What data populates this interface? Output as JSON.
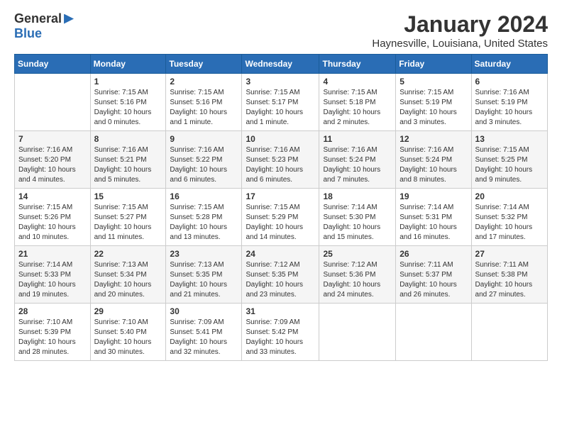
{
  "header": {
    "logo_general": "General",
    "logo_blue": "Blue",
    "month": "January 2024",
    "location": "Haynesville, Louisiana, United States"
  },
  "days_of_week": [
    "Sunday",
    "Monday",
    "Tuesday",
    "Wednesday",
    "Thursday",
    "Friday",
    "Saturday"
  ],
  "weeks": [
    [
      {
        "day": "",
        "info": ""
      },
      {
        "day": "1",
        "info": "Sunrise: 7:15 AM\nSunset: 5:16 PM\nDaylight: 10 hours\nand 0 minutes."
      },
      {
        "day": "2",
        "info": "Sunrise: 7:15 AM\nSunset: 5:16 PM\nDaylight: 10 hours\nand 1 minute."
      },
      {
        "day": "3",
        "info": "Sunrise: 7:15 AM\nSunset: 5:17 PM\nDaylight: 10 hours\nand 1 minute."
      },
      {
        "day": "4",
        "info": "Sunrise: 7:15 AM\nSunset: 5:18 PM\nDaylight: 10 hours\nand 2 minutes."
      },
      {
        "day": "5",
        "info": "Sunrise: 7:15 AM\nSunset: 5:19 PM\nDaylight: 10 hours\nand 3 minutes."
      },
      {
        "day": "6",
        "info": "Sunrise: 7:16 AM\nSunset: 5:19 PM\nDaylight: 10 hours\nand 3 minutes."
      }
    ],
    [
      {
        "day": "7",
        "info": "Sunrise: 7:16 AM\nSunset: 5:20 PM\nDaylight: 10 hours\nand 4 minutes."
      },
      {
        "day": "8",
        "info": "Sunrise: 7:16 AM\nSunset: 5:21 PM\nDaylight: 10 hours\nand 5 minutes."
      },
      {
        "day": "9",
        "info": "Sunrise: 7:16 AM\nSunset: 5:22 PM\nDaylight: 10 hours\nand 6 minutes."
      },
      {
        "day": "10",
        "info": "Sunrise: 7:16 AM\nSunset: 5:23 PM\nDaylight: 10 hours\nand 6 minutes."
      },
      {
        "day": "11",
        "info": "Sunrise: 7:16 AM\nSunset: 5:24 PM\nDaylight: 10 hours\nand 7 minutes."
      },
      {
        "day": "12",
        "info": "Sunrise: 7:16 AM\nSunset: 5:24 PM\nDaylight: 10 hours\nand 8 minutes."
      },
      {
        "day": "13",
        "info": "Sunrise: 7:15 AM\nSunset: 5:25 PM\nDaylight: 10 hours\nand 9 minutes."
      }
    ],
    [
      {
        "day": "14",
        "info": "Sunrise: 7:15 AM\nSunset: 5:26 PM\nDaylight: 10 hours\nand 10 minutes."
      },
      {
        "day": "15",
        "info": "Sunrise: 7:15 AM\nSunset: 5:27 PM\nDaylight: 10 hours\nand 11 minutes."
      },
      {
        "day": "16",
        "info": "Sunrise: 7:15 AM\nSunset: 5:28 PM\nDaylight: 10 hours\nand 13 minutes."
      },
      {
        "day": "17",
        "info": "Sunrise: 7:15 AM\nSunset: 5:29 PM\nDaylight: 10 hours\nand 14 minutes."
      },
      {
        "day": "18",
        "info": "Sunrise: 7:14 AM\nSunset: 5:30 PM\nDaylight: 10 hours\nand 15 minutes."
      },
      {
        "day": "19",
        "info": "Sunrise: 7:14 AM\nSunset: 5:31 PM\nDaylight: 10 hours\nand 16 minutes."
      },
      {
        "day": "20",
        "info": "Sunrise: 7:14 AM\nSunset: 5:32 PM\nDaylight: 10 hours\nand 17 minutes."
      }
    ],
    [
      {
        "day": "21",
        "info": "Sunrise: 7:14 AM\nSunset: 5:33 PM\nDaylight: 10 hours\nand 19 minutes."
      },
      {
        "day": "22",
        "info": "Sunrise: 7:13 AM\nSunset: 5:34 PM\nDaylight: 10 hours\nand 20 minutes."
      },
      {
        "day": "23",
        "info": "Sunrise: 7:13 AM\nSunset: 5:35 PM\nDaylight: 10 hours\nand 21 minutes."
      },
      {
        "day": "24",
        "info": "Sunrise: 7:12 AM\nSunset: 5:35 PM\nDaylight: 10 hours\nand 23 minutes."
      },
      {
        "day": "25",
        "info": "Sunrise: 7:12 AM\nSunset: 5:36 PM\nDaylight: 10 hours\nand 24 minutes."
      },
      {
        "day": "26",
        "info": "Sunrise: 7:11 AM\nSunset: 5:37 PM\nDaylight: 10 hours\nand 26 minutes."
      },
      {
        "day": "27",
        "info": "Sunrise: 7:11 AM\nSunset: 5:38 PM\nDaylight: 10 hours\nand 27 minutes."
      }
    ],
    [
      {
        "day": "28",
        "info": "Sunrise: 7:10 AM\nSunset: 5:39 PM\nDaylight: 10 hours\nand 28 minutes."
      },
      {
        "day": "29",
        "info": "Sunrise: 7:10 AM\nSunset: 5:40 PM\nDaylight: 10 hours\nand 30 minutes."
      },
      {
        "day": "30",
        "info": "Sunrise: 7:09 AM\nSunset: 5:41 PM\nDaylight: 10 hours\nand 32 minutes."
      },
      {
        "day": "31",
        "info": "Sunrise: 7:09 AM\nSunset: 5:42 PM\nDaylight: 10 hours\nand 33 minutes."
      },
      {
        "day": "",
        "info": ""
      },
      {
        "day": "",
        "info": ""
      },
      {
        "day": "",
        "info": ""
      }
    ]
  ]
}
